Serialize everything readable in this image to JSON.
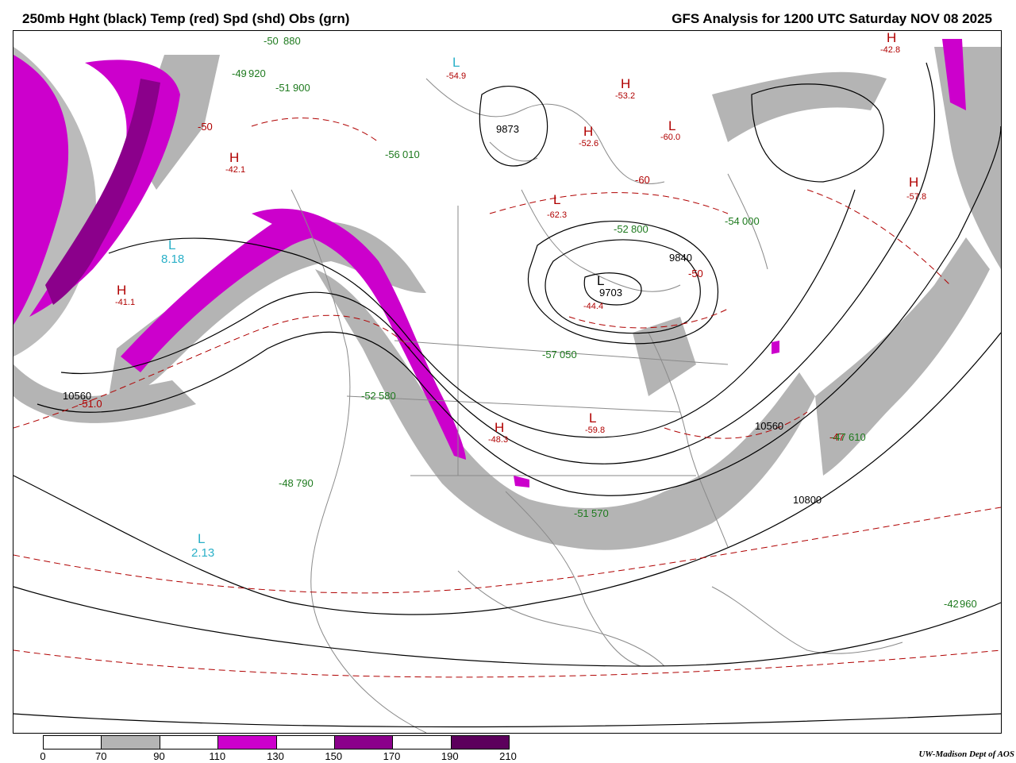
{
  "title_left": "250mb Hght (black) Temp (red) Spd (shd) Obs (grn)",
  "title_right": "GFS Analysis for 1200 UTC Saturday  NOV 08 2025",
  "credit": "UW-Madison  Dept of AOS",
  "legend": {
    "ticks": [
      "0",
      "70",
      "90",
      "110",
      "130",
      "150",
      "170",
      "190",
      "210"
    ],
    "colors": [
      "#ffffff",
      "#b4b4b4",
      "#ffffff",
      "#cc00cc",
      "#ffffff",
      "#8b008b",
      "#ffffff",
      "#5c005c"
    ]
  },
  "pressure_centers": [
    {
      "type": "H",
      "temp": "-42.1"
    },
    {
      "type": "H",
      "temp": "-41.1"
    },
    {
      "type": "L",
      "temp": "8.18"
    },
    {
      "type": "L",
      "temp": "-54.9"
    },
    {
      "type": "H",
      "temp": "-52.6"
    },
    {
      "type": "L",
      "temp": "-60.0"
    },
    {
      "type": "H",
      "temp": "-53.2"
    },
    {
      "type": "H",
      "temp": "-42.8"
    },
    {
      "type": "L",
      "temp": "-62.3"
    },
    {
      "type": "L",
      "temp": "-44.4"
    },
    {
      "type": "H",
      "temp": "-57.8"
    },
    {
      "type": "L",
      "temp": "-59.8"
    },
    {
      "type": "H",
      "temp": "-48.3"
    },
    {
      "type": "L",
      "temp": "2.13"
    }
  ],
  "height_labels": [
    "10560",
    "9840",
    "9703",
    "10560",
    "10800",
    "9873"
  ],
  "temp_labels": [
    "-50",
    "-51.0",
    "-60",
    "-50",
    "-47"
  ],
  "obs_samples": [
    {
      "t": "-50",
      "h": "880"
    },
    {
      "t": "-51",
      "h": "900"
    },
    {
      "t": "-49",
      "h": "920"
    },
    {
      "t": "-56",
      "h": "010"
    },
    {
      "t": "-52",
      "h": "580"
    },
    {
      "t": "-57",
      "h": "050"
    },
    {
      "t": "-52",
      "h": "800"
    },
    {
      "t": "-54",
      "h": "000"
    },
    {
      "t": "-47",
      "h": "610"
    },
    {
      "t": "-48",
      "h": "790"
    },
    {
      "t": "-51",
      "h": "570"
    },
    {
      "t": "-42",
      "h": "960"
    }
  ]
}
